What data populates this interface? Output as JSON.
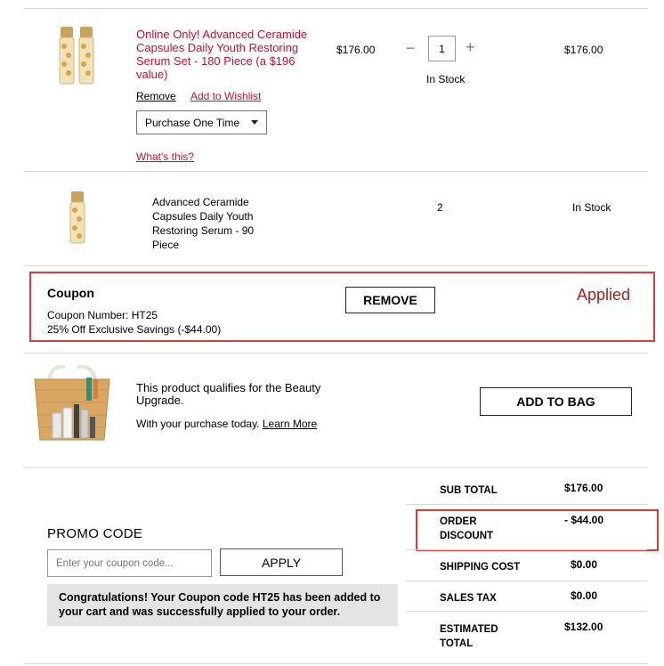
{
  "item1": {
    "title": "Online Only! Advanced Ceramide Capsules Daily Youth Restoring Serum Set - 180 Piece (a $196 value)",
    "price": "$176.00",
    "quantity": "1",
    "stock": "In Stock",
    "total": "$176.00",
    "remove_label": "Remove",
    "wishlist_label": "Add to Wishlist",
    "purchase_option": "Purchase One Time",
    "whats_this": "What's this?"
  },
  "item2": {
    "title": "Advanced Ceramide Capsules Daily Youth Restoring Serum - 90 Piece",
    "quantity": "2",
    "stock": "In Stock"
  },
  "coupon": {
    "heading": "Coupon",
    "number": "Coupon Number: HT25",
    "savings": "25% Off Exclusive Savings (-$44.00)",
    "remove_label": "REMOVE",
    "status": "Applied"
  },
  "upgrade": {
    "text": "This product qualifies for the Beauty Upgrade.",
    "subtext": "With your purchase today.",
    "learn_more": "Learn More",
    "add_label": "ADD TO BAG"
  },
  "promo": {
    "heading": "PROMO CODE",
    "placeholder": "Enter your coupon code...",
    "apply_label": "APPLY",
    "message": "Congratulations! Your Coupon code HT25 has been added to your cart and was successfully applied to your order."
  },
  "summary": {
    "subtotal_label": "SUB TOTAL",
    "subtotal": "$176.00",
    "discount_label": "ORDER DISCOUNT",
    "discount": "- $44.00",
    "shipping_label": "SHIPPING COST",
    "shipping": "$0.00",
    "tax_label": "SALES TAX",
    "tax": "$0.00",
    "total_label": "ESTIMATED TOTAL",
    "total": "$132.00"
  },
  "colors": {
    "accent_red": "#c8102e",
    "highlight_box": "#e23a3a",
    "message_bg": "#e4e4e4"
  }
}
